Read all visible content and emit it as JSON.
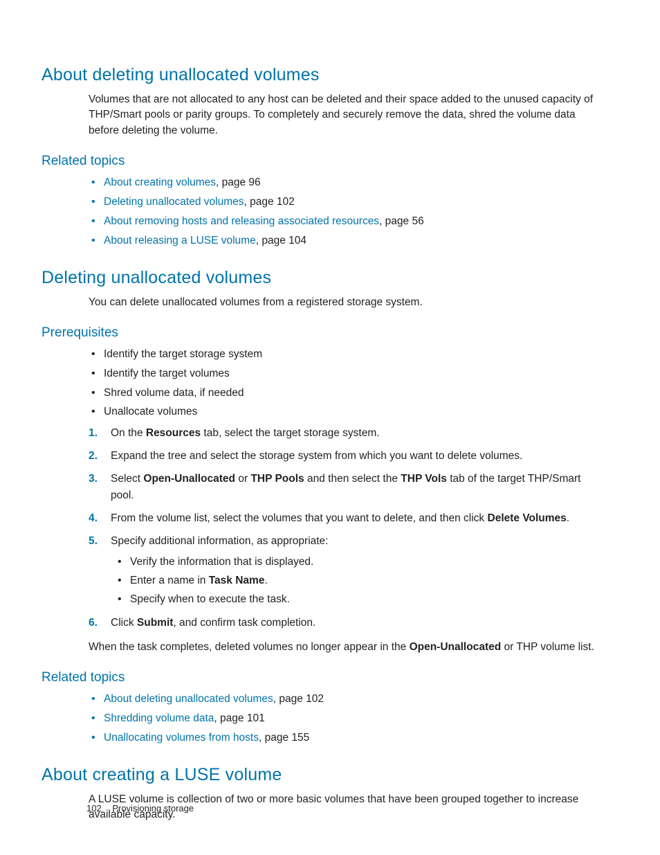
{
  "sec1": {
    "heading": "About deleting unallocated volumes",
    "para": "Volumes that are not allocated to any host can be deleted and their space added to the unused capacity of THP/Smart pools or parity groups. To completely and securely remove the data, shred the volume data before deleting the volume.",
    "related_heading": "Related topics",
    "related": [
      {
        "link": "About creating volumes",
        "tail": ", page 96"
      },
      {
        "link": "Deleting unallocated volumes",
        "tail": ", page 102"
      },
      {
        "link": "About removing hosts and releasing associated resources",
        "tail": ", page 56"
      },
      {
        "link": "About releasing a LUSE volume",
        "tail": ", page 104"
      }
    ]
  },
  "sec2": {
    "heading": "Deleting unallocated volumes",
    "para": "You can delete unallocated volumes from a registered storage system.",
    "prereq_heading": "Prerequisites",
    "prereq": [
      "Identify the target storage system",
      "Identify the target volumes",
      "Shred volume data, if needed",
      "Unallocate volumes"
    ],
    "steps": {
      "s1a": "On the ",
      "s1b": "Resources",
      "s1c": " tab, select the target storage system.",
      "s2": "Expand the tree and select the storage system from which you want to delete volumes.",
      "s3a": "Select ",
      "s3b": "Open-Unallocated",
      "s3c": " or ",
      "s3d": "THP Pools",
      "s3e": " and then select the ",
      "s3f": "THP Vols",
      "s3g": " tab of the target THP/Smart pool.",
      "s4a": "From the volume list, select the volumes that you want to delete, and then click ",
      "s4b": "Delete Volumes",
      "s4c": ".",
      "s5": "Specify additional information, as appropriate:",
      "s5sub1": "Verify the information that is displayed.",
      "s5sub2a": "Enter a name in ",
      "s5sub2b": "Task Name",
      "s5sub2c": ".",
      "s5sub3": "Specify when to execute the task.",
      "s6a": "Click ",
      "s6b": "Submit",
      "s6c": ", and confirm task completion."
    },
    "closing_a": "When the task completes, deleted volumes no longer appear in the ",
    "closing_b": "Open-Unallocated",
    "closing_c": " or THP volume list.",
    "related_heading": "Related topics",
    "related": [
      {
        "link": "About deleting unallocated volumes",
        "tail": ", page 102"
      },
      {
        "link": "Shredding volume data",
        "tail": ", page 101"
      },
      {
        "link": "Unallocating volumes from hosts",
        "tail": ", page 155"
      }
    ]
  },
  "sec3": {
    "heading": "About creating a LUSE volume",
    "para": "A LUSE volume is collection of two or more basic volumes that have been grouped together to increase available capacity."
  },
  "footer": {
    "page": "102",
    "title": "Provisioning storage"
  }
}
